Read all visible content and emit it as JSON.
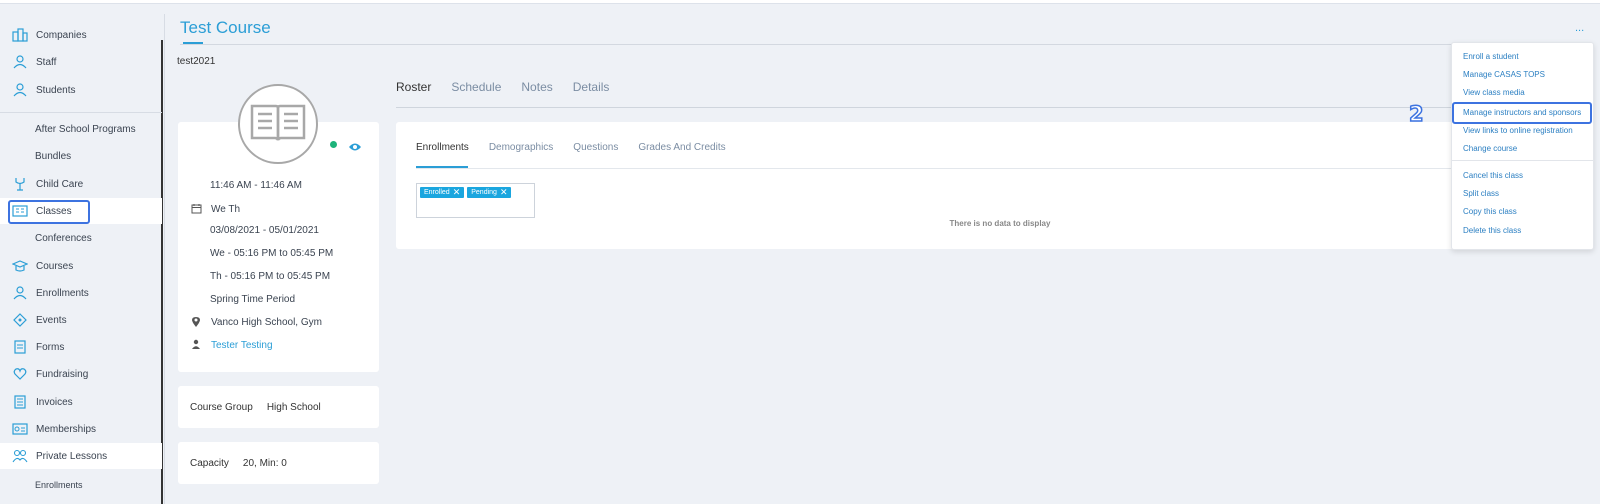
{
  "sidebar": {
    "items": [
      {
        "label": "Companies",
        "icon": "companies-icon"
      },
      {
        "label": "Staff",
        "icon": "staff-icon"
      },
      {
        "label": "Students",
        "icon": "students-icon"
      },
      {
        "label": "After School Programs",
        "icon": ""
      },
      {
        "label": "Bundles",
        "icon": ""
      },
      {
        "label": "Child Care",
        "icon": "child-care-icon"
      },
      {
        "label": "Classes",
        "icon": "classes-icon"
      },
      {
        "label": "Conferences",
        "icon": ""
      },
      {
        "label": "Courses",
        "icon": "courses-icon"
      },
      {
        "label": "Enrollments",
        "icon": "enrollments-icon"
      },
      {
        "label": "Events",
        "icon": "events-icon"
      },
      {
        "label": "Forms",
        "icon": "forms-icon"
      },
      {
        "label": "Fundraising",
        "icon": "fundraising-icon"
      },
      {
        "label": "Invoices",
        "icon": "invoices-icon"
      },
      {
        "label": "Memberships",
        "icon": "memberships-icon"
      },
      {
        "label": "Private Lessons",
        "icon": "private-lessons-icon"
      },
      {
        "label": "Enrollments",
        "icon": ""
      }
    ]
  },
  "header": {
    "title": "Test Course",
    "more": "...",
    "course_code": "test2021"
  },
  "info": {
    "time": "11:46 AM - 11:46 AM",
    "days": "We Th",
    "dates": "03/08/2021 - 05/01/2021",
    "schedule_we": "We - 05:16 PM to 05:45 PM",
    "schedule_th": "Th - 05:16 PM to 05:45 PM",
    "period": "Spring Time Period",
    "location": "Vanco High School, Gym",
    "instructor": "Tester Testing"
  },
  "course_group": {
    "label": "Course Group",
    "value": "High School"
  },
  "capacity": {
    "label": "Capacity",
    "value": "20, Min: 0"
  },
  "main_tabs": [
    "Roster",
    "Schedule",
    "Notes",
    "Details"
  ],
  "sub_tabs": [
    "Enrollments",
    "Demographics",
    "Questions",
    "Grades And Credits"
  ],
  "filters": [
    "Enrolled",
    "Pending"
  ],
  "filter_remove": "✕",
  "empty_message": "There is no data to display",
  "menu": {
    "items": [
      "Enroll a student",
      "Manage CASAS TOPS",
      "View class media",
      "Manage instructors and sponsors",
      "View links to online registration",
      "Change course",
      "Cancel this class",
      "Split class",
      "Copy this class",
      "Delete this class"
    ]
  },
  "step_badge": "2",
  "colors": {
    "accent": "#2b9ed6",
    "highlight": "#3d73e0",
    "chip": "#1aa6df",
    "status": "#1db37a"
  }
}
